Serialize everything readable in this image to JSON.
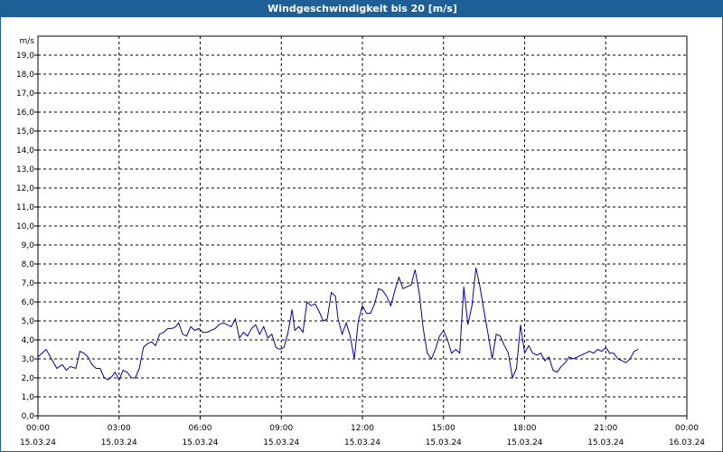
{
  "window": {
    "title": "Windgeschwindigkeit bis 20 [m/s]"
  },
  "colors": {
    "titlebar": "#1e5f98",
    "line": "#0000aa",
    "grid": "#000000"
  },
  "chart_data": {
    "type": "line",
    "title": "Windgeschwindigkeit bis 20 [m/s]",
    "ylabel": "m/s",
    "ylim": [
      0,
      20
    ],
    "y_ticks": [
      "0,0",
      "1,0",
      "2,0",
      "3,0",
      "4,0",
      "5,0",
      "6,0",
      "7,0",
      "8,0",
      "9,0",
      "10,0",
      "11,0",
      "12,0",
      "13,0",
      "14,0",
      "15,0",
      "16,0",
      "17,0",
      "18,0",
      "19,0"
    ],
    "xlim_hours": [
      0,
      24
    ],
    "x_ticks": [
      {
        "time": "00:00",
        "date": "15.03.24"
      },
      {
        "time": "03:00",
        "date": "15.03.24"
      },
      {
        "time": "06:00",
        "date": "15.03.24"
      },
      {
        "time": "09:00",
        "date": "15.03.24"
      },
      {
        "time": "12:00",
        "date": "15.03.24"
      },
      {
        "time": "15:00",
        "date": "15.03.24"
      },
      {
        "time": "18:00",
        "date": "15.03.24"
      },
      {
        "time": "21:00",
        "date": "15.03.24"
      },
      {
        "time": "00:00",
        "date": "16.03.24"
      }
    ],
    "grid": true,
    "series": [
      {
        "values": [
          [
            0.0,
            3.1
          ],
          [
            0.15,
            3.3
          ],
          [
            0.3,
            3.5
          ],
          [
            0.5,
            3.0
          ],
          [
            0.7,
            2.5
          ],
          [
            0.9,
            2.7
          ],
          [
            1.05,
            2.4
          ],
          [
            1.2,
            2.6
          ],
          [
            1.4,
            2.5
          ],
          [
            1.55,
            3.4
          ],
          [
            1.7,
            3.3
          ],
          [
            1.85,
            3.1
          ],
          [
            2.0,
            2.7
          ],
          [
            2.15,
            2.5
          ],
          [
            2.3,
            2.5
          ],
          [
            2.45,
            2.0
          ],
          [
            2.6,
            1.9
          ],
          [
            2.75,
            2.1
          ],
          [
            2.85,
            2.3
          ],
          [
            3.0,
            1.9
          ],
          [
            3.15,
            2.4
          ],
          [
            3.3,
            2.3
          ],
          [
            3.45,
            2.0
          ],
          [
            3.6,
            2.0
          ],
          [
            3.75,
            2.5
          ],
          [
            3.9,
            3.6
          ],
          [
            4.05,
            3.8
          ],
          [
            4.2,
            3.9
          ],
          [
            4.35,
            3.7
          ],
          [
            4.5,
            4.3
          ],
          [
            4.65,
            4.4
          ],
          [
            4.8,
            4.6
          ],
          [
            4.95,
            4.6
          ],
          [
            5.1,
            4.7
          ],
          [
            5.2,
            4.9
          ],
          [
            5.35,
            4.3
          ],
          [
            5.5,
            4.2
          ],
          [
            5.65,
            4.7
          ],
          [
            5.8,
            4.5
          ],
          [
            5.95,
            4.6
          ],
          [
            6.1,
            4.4
          ],
          [
            6.25,
            4.4
          ],
          [
            6.4,
            4.5
          ],
          [
            6.55,
            4.6
          ],
          [
            6.7,
            4.8
          ],
          [
            6.85,
            4.9
          ],
          [
            7.0,
            4.8
          ],
          [
            7.15,
            4.7
          ],
          [
            7.3,
            5.1
          ],
          [
            7.45,
            4.1
          ],
          [
            7.6,
            4.4
          ],
          [
            7.75,
            4.2
          ],
          [
            7.9,
            4.6
          ],
          [
            8.05,
            4.8
          ],
          [
            8.2,
            4.3
          ],
          [
            8.35,
            4.7
          ],
          [
            8.5,
            4.1
          ],
          [
            8.65,
            4.3
          ],
          [
            8.8,
            3.6
          ],
          [
            8.95,
            3.5
          ],
          [
            9.1,
            3.6
          ],
          [
            9.25,
            4.4
          ],
          [
            9.4,
            5.6
          ],
          [
            9.5,
            4.5
          ],
          [
            9.65,
            4.7
          ],
          [
            9.8,
            4.4
          ],
          [
            9.95,
            6.0
          ],
          [
            10.1,
            5.8
          ],
          [
            10.25,
            5.9
          ],
          [
            10.4,
            5.5
          ],
          [
            10.55,
            5.0
          ],
          [
            10.7,
            5.1
          ],
          [
            10.85,
            6.5
          ],
          [
            11.0,
            6.3
          ],
          [
            11.1,
            5.1
          ],
          [
            11.25,
            4.3
          ],
          [
            11.4,
            4.9
          ],
          [
            11.55,
            4.2
          ],
          [
            11.7,
            3.0
          ],
          [
            11.85,
            5.0
          ],
          [
            12.0,
            5.8
          ],
          [
            12.15,
            5.4
          ],
          [
            12.3,
            5.4
          ],
          [
            12.45,
            5.9
          ],
          [
            12.6,
            6.7
          ],
          [
            12.75,
            6.6
          ],
          [
            12.9,
            6.3
          ],
          [
            13.05,
            5.8
          ],
          [
            13.2,
            6.6
          ],
          [
            13.35,
            7.3
          ],
          [
            13.5,
            6.7
          ],
          [
            13.65,
            6.8
          ],
          [
            13.8,
            6.9
          ],
          [
            13.95,
            7.7
          ],
          [
            14.1,
            6.5
          ],
          [
            14.25,
            4.6
          ],
          [
            14.4,
            3.3
          ],
          [
            14.55,
            3.0
          ],
          [
            14.7,
            3.5
          ],
          [
            14.85,
            4.2
          ],
          [
            15.0,
            4.5
          ],
          [
            15.15,
            4.0
          ],
          [
            15.3,
            3.3
          ],
          [
            15.45,
            3.5
          ],
          [
            15.6,
            3.3
          ],
          [
            15.75,
            6.8
          ],
          [
            15.9,
            4.8
          ],
          [
            16.05,
            5.8
          ],
          [
            16.2,
            7.8
          ],
          [
            16.35,
            6.8
          ],
          [
            16.5,
            5.5
          ],
          [
            16.65,
            4.3
          ],
          [
            16.8,
            3.0
          ],
          [
            16.95,
            4.3
          ],
          [
            17.1,
            4.2
          ],
          [
            17.25,
            3.7
          ],
          [
            17.4,
            3.3
          ],
          [
            17.55,
            2.0
          ],
          [
            17.7,
            2.5
          ],
          [
            17.85,
            4.8
          ],
          [
            18.0,
            3.3
          ],
          [
            18.15,
            3.7
          ],
          [
            18.3,
            3.3
          ],
          [
            18.45,
            3.2
          ],
          [
            18.6,
            3.3
          ],
          [
            18.75,
            2.9
          ],
          [
            18.9,
            3.1
          ],
          [
            19.05,
            2.4
          ],
          [
            19.2,
            2.3
          ],
          [
            19.35,
            2.6
          ],
          [
            19.5,
            2.8
          ],
          [
            19.65,
            3.1
          ],
          [
            19.8,
            3.0
          ],
          [
            19.95,
            3.1
          ],
          [
            20.1,
            3.2
          ],
          [
            20.25,
            3.3
          ],
          [
            20.4,
            3.4
          ],
          [
            20.55,
            3.3
          ],
          [
            20.7,
            3.5
          ],
          [
            20.85,
            3.4
          ],
          [
            21.0,
            3.6
          ],
          [
            21.15,
            3.3
          ],
          [
            21.3,
            3.3
          ],
          [
            21.45,
            3.0
          ],
          [
            21.6,
            2.9
          ],
          [
            21.75,
            2.8
          ],
          [
            21.9,
            3.0
          ],
          [
            22.05,
            3.4
          ],
          [
            22.2,
            3.5
          ]
        ]
      }
    ]
  }
}
